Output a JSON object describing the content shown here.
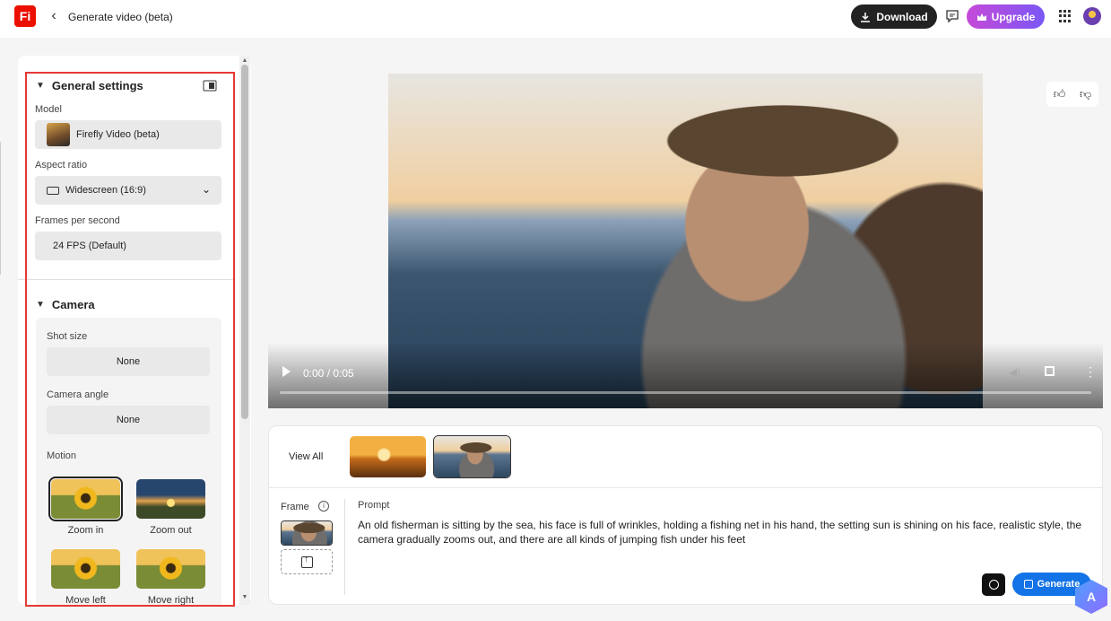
{
  "app": {
    "logo_text": "Fi",
    "page_title": "Generate video (beta)",
    "brand_color": "#eb1000"
  },
  "topbar": {
    "download_label": "Download",
    "upgrade_label": "Upgrade",
    "icons": [
      "back-arrow-icon",
      "download-icon",
      "comment-icon",
      "crown-icon",
      "apps-grid-icon",
      "avatar"
    ]
  },
  "general_settings": {
    "title": "General settings",
    "model_label": "Model",
    "model_value": "Firefly Video (beta)",
    "aspect_label": "Aspect ratio",
    "aspect_value": "Widescreen (16:9)",
    "fps_label": "Frames per second",
    "fps_value": "24 FPS (Default)"
  },
  "camera": {
    "title": "Camera",
    "shot_size_label": "Shot size",
    "shot_size_value": "None",
    "camera_angle_label": "Camera angle",
    "camera_angle_value": "None",
    "motion_label": "Motion",
    "motions": [
      {
        "label": "Zoom in",
        "selected": true
      },
      {
        "label": "Zoom out",
        "selected": false
      },
      {
        "label": "Move left",
        "selected": false
      },
      {
        "label": "Move right",
        "selected": false
      }
    ]
  },
  "video": {
    "time": "0:00 / 0:05",
    "progress": 0
  },
  "history": {
    "view_all_label": "View All"
  },
  "prompt": {
    "frame_label": "Frame",
    "prompt_label": "Prompt",
    "prompt_text": "An old fisherman is sitting by the sea, his face is full of wrinkles, holding a fishing net in his hand, the setting sun is shining on his face, realistic style, the camera gradually zooms out, and there are all kinds of jumping fish under his feet",
    "generate_label": "Generate"
  },
  "colors": {
    "primary_button": "#1473e6",
    "highlight_border": "#e53935"
  }
}
